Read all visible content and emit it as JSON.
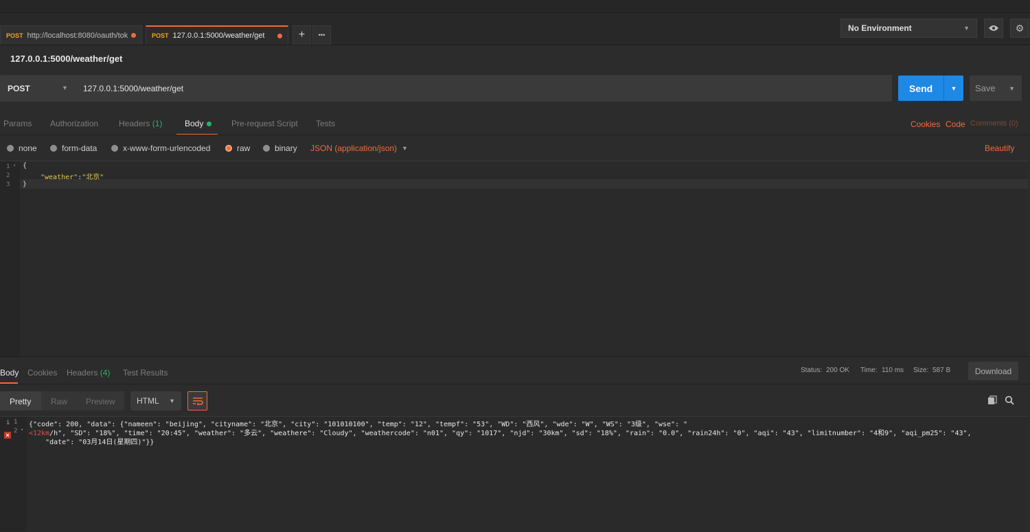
{
  "tabs": [
    {
      "method": "POST",
      "title": "http://localhost:8080/oauth/tok",
      "active": false
    },
    {
      "method": "POST",
      "title": "127.0.0.1:5000/weather/get",
      "active": true
    }
  ],
  "tabbar": {
    "add_symbol": "+",
    "more_symbol": "•••"
  },
  "environment": {
    "selected": "No Environment"
  },
  "request": {
    "title": "127.0.0.1:5000/weather/get",
    "method": "POST",
    "url": "127.0.0.1:5000/weather/get",
    "send_label": "Send",
    "save_label": "Save"
  },
  "request_tabs": {
    "params": "Params",
    "authorization": "Authorization",
    "headers": "Headers",
    "headers_count": "(1)",
    "body": "Body",
    "prerequest": "Pre-request Script",
    "tests": "Tests",
    "cookies": "Cookies",
    "code": "Code",
    "comments": "Comments (0)"
  },
  "body_modes": {
    "none": "none",
    "form_data": "form-data",
    "urlencoded": "x-www-form-urlencoded",
    "raw": "raw",
    "binary": "binary",
    "content_type": "JSON (application/json)",
    "beautify": "Beautify"
  },
  "request_body": {
    "line_numbers": [
      "1",
      "2",
      "3"
    ],
    "line1": "{",
    "line2_key": "\"weather\"",
    "line2_colon": ":",
    "line2_value": "\"北京\"",
    "line3": "}"
  },
  "response_tabs": {
    "body": "Body",
    "cookies": "Cookies",
    "headers": "Headers",
    "headers_count": "(4)",
    "test_results": "Test Results"
  },
  "response_meta": {
    "status_label": "Status:",
    "status_value": "200 OK",
    "time_label": "Time:",
    "time_value": "110 ms",
    "size_label": "Size:",
    "size_value": "587 B",
    "download_label": "Download"
  },
  "response_view": {
    "pretty": "Pretty",
    "raw": "Raw",
    "preview": "Preview",
    "format": "HTML"
  },
  "response_body": {
    "line_numbers": [
      "1",
      "2"
    ],
    "info_mark": "i",
    "error_mark": "×",
    "line1": "{\"code\": 200, \"data\": {\"nameen\": \"beijing\", \"cityname\": \"北京\", \"city\": \"101010100\", \"temp\": \"12\", \"tempf\": \"53\", \"WD\": \"西风\", \"wde\": \"W\", \"WS\": \"3级\", \"wse\": \"",
    "line2_error": "<12km",
    "line2": "/h\", \"SD\": \"18%\", \"time\": \"20:45\", \"weather\": \"多云\", \"weathere\": \"Cloudy\", \"weathercode\": \"n01\", \"qy\": \"1017\", \"njd\": \"30km\", \"sd\": \"18%\", \"rain\": \"0.0\", \"rain24h\": \"0\", \"aqi\": \"43\", \"limitnumber\": \"4和9\", \"aqi_pm25\": \"43\",",
    "line3": "    \"date\": \"03月14日(星期四)\"}}"
  },
  "colors": {
    "accent": "#f26b3a",
    "send": "#1e88e5",
    "success": "#29b369",
    "method_tab": "#f4a51c"
  }
}
